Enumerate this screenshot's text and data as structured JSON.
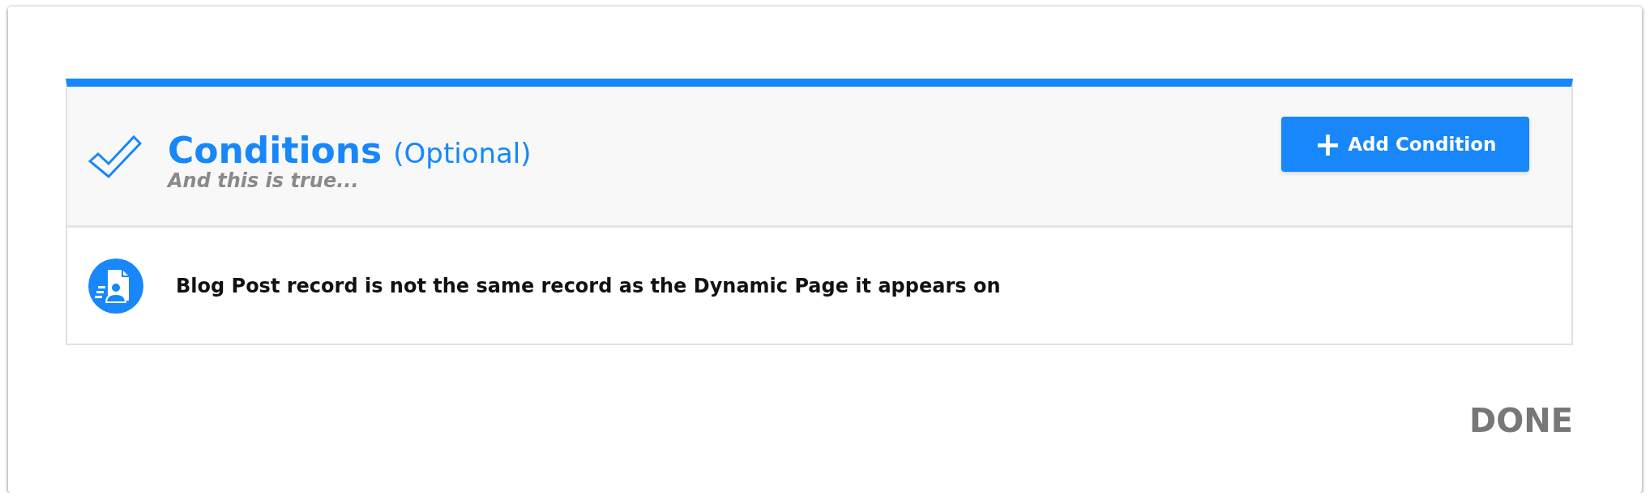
{
  "section": {
    "title": "Conditions",
    "optional_label": "(Optional)",
    "subtitle": "And this is true...",
    "add_button": {
      "icon": "+",
      "label": "Add Condition"
    }
  },
  "conditions": [
    {
      "kind": "record",
      "text": "Blog Post record is not the same record as the Dynamic Page it appears on"
    }
  ],
  "footer": {
    "done_label": "DONE"
  }
}
